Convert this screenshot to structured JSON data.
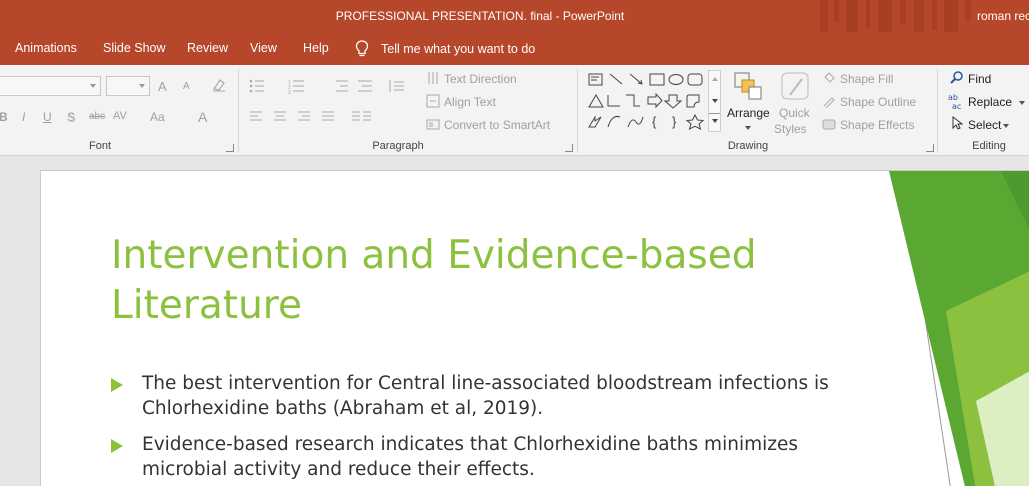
{
  "window": {
    "title": "PROFESSIONAL PRESENTATION. final  -  PowerPoint",
    "user": "roman rec"
  },
  "tabs": [
    {
      "label": "Animations"
    },
    {
      "label": "Slide Show"
    },
    {
      "label": "Review"
    },
    {
      "label": "View"
    },
    {
      "label": "Help"
    }
  ],
  "tellme": {
    "label": "Tell me what you want to do",
    "icon": "lightbulb-icon"
  },
  "ribbon": {
    "font": {
      "label": "Font",
      "bold": "B",
      "italic": "I",
      "underline": "U",
      "shadow": "S",
      "strike": "abc",
      "spacing": "AV",
      "case": "Aa",
      "color": "A",
      "grow": "A",
      "shrink": "A"
    },
    "paragraph": {
      "label": "Paragraph",
      "text_direction": "Text Direction",
      "align_text": "Align Text",
      "smartart": "Convert to SmartArt"
    },
    "drawing": {
      "label": "Drawing",
      "arrange": "Arrange",
      "quick_styles_1": "Quick",
      "quick_styles_2": "Styles",
      "shape_fill": "Shape Fill",
      "shape_outline": "Shape Outline",
      "shape_effects": "Shape Effects"
    },
    "editing": {
      "label": "Editing",
      "find": "Find",
      "replace": "Replace",
      "select": "Select"
    }
  },
  "slide": {
    "title_line1": "Intervention and Evidence-based",
    "title_line2": "Literature",
    "bullets": [
      {
        "line1": "The best intervention for Central line-associated bloodstream infections is",
        "line2": "Chlorhexidine baths (Abraham et al, 2019)."
      },
      {
        "line1": "Evidence-based research indicates that Chlorhexidine baths minimizes",
        "line2": "microbial activity and reduce their effects."
      }
    ]
  },
  "colors": {
    "accent": "#b7472a",
    "title_green": "#8cc13f",
    "deco_dark_green": "#4e9a2f",
    "deco_light_green": "#c3df9a"
  }
}
